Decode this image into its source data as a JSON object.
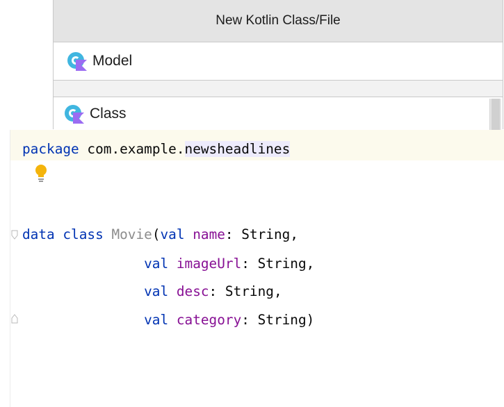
{
  "dialog": {
    "title": "New Kotlin Class/File",
    "name_value": "Model",
    "kinds": [
      {
        "label": "Class",
        "icon": "kotlin-class-icon",
        "selected": false
      }
    ]
  },
  "editor": {
    "package_line": {
      "keyword": "package",
      "prefix": "com.example.",
      "highlighted": "newsheadlines"
    },
    "class_line": {
      "kw1": "data class",
      "class_name": "Movie",
      "open_paren": "(",
      "val_kw": "val",
      "param": "name",
      "type_part": ": String,"
    },
    "params": [
      {
        "val_kw": "val",
        "name": "imageUrl",
        "type_part": ": String,"
      },
      {
        "val_kw": "val",
        "name": "desc",
        "type_part": ": String,"
      },
      {
        "val_kw": "val",
        "name": "category",
        "type_part": ": String)"
      }
    ]
  },
  "colors": {
    "keyword": "#0033b3",
    "property": "#871094",
    "unused_class": "#8c8c8c",
    "kotlin_icon": "#40b6e0",
    "kotlin_badge": "#9b6cf2",
    "current_line": "#fcfaed",
    "selection_highlight": "#edebfc",
    "bulb": "#f4b40c"
  }
}
